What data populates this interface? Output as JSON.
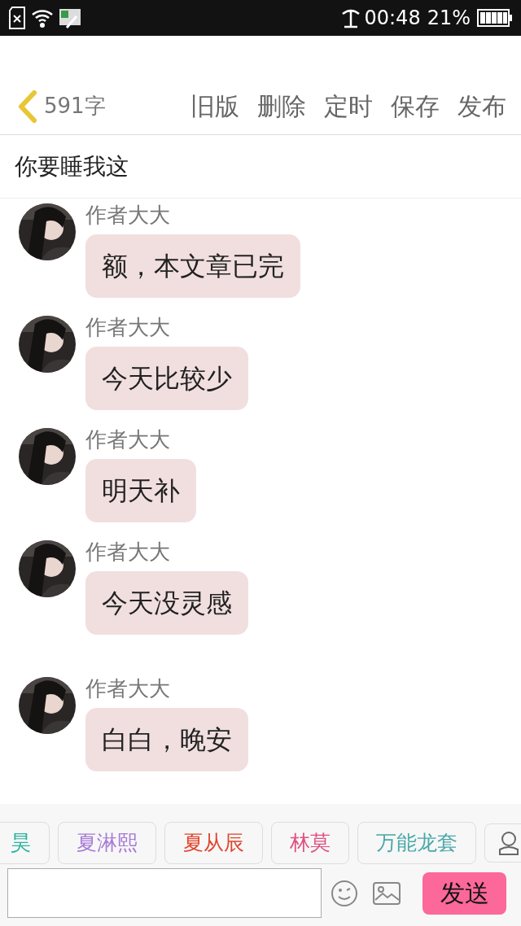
{
  "status_bar": {
    "time": "00:48",
    "battery": "21%"
  },
  "toolbar": {
    "back": "591字",
    "actions": [
      "旧版",
      "删除",
      "定时",
      "保存",
      "发布"
    ]
  },
  "title": "你要睡我这",
  "messages": [
    {
      "author": "作者大大",
      "text": "额，本文章已完"
    },
    {
      "author": "作者大大",
      "text": "今天比较少"
    },
    {
      "author": "作者大大",
      "text": "明天补"
    },
    {
      "author": "作者大大",
      "text": "今天没灵感"
    },
    {
      "author": "作者大大",
      "text": "白白，晚安"
    }
  ],
  "characters": [
    {
      "name": "昊",
      "color": "#2bb5a0"
    },
    {
      "name": "夏淋熙",
      "color": "#a77bd6"
    },
    {
      "name": "夏从辰",
      "color": "#e0452f"
    },
    {
      "name": "林莫",
      "color": "#e0507f"
    },
    {
      "name": "万能龙套",
      "color": "#4aa8a8"
    }
  ],
  "send_button": "发送"
}
